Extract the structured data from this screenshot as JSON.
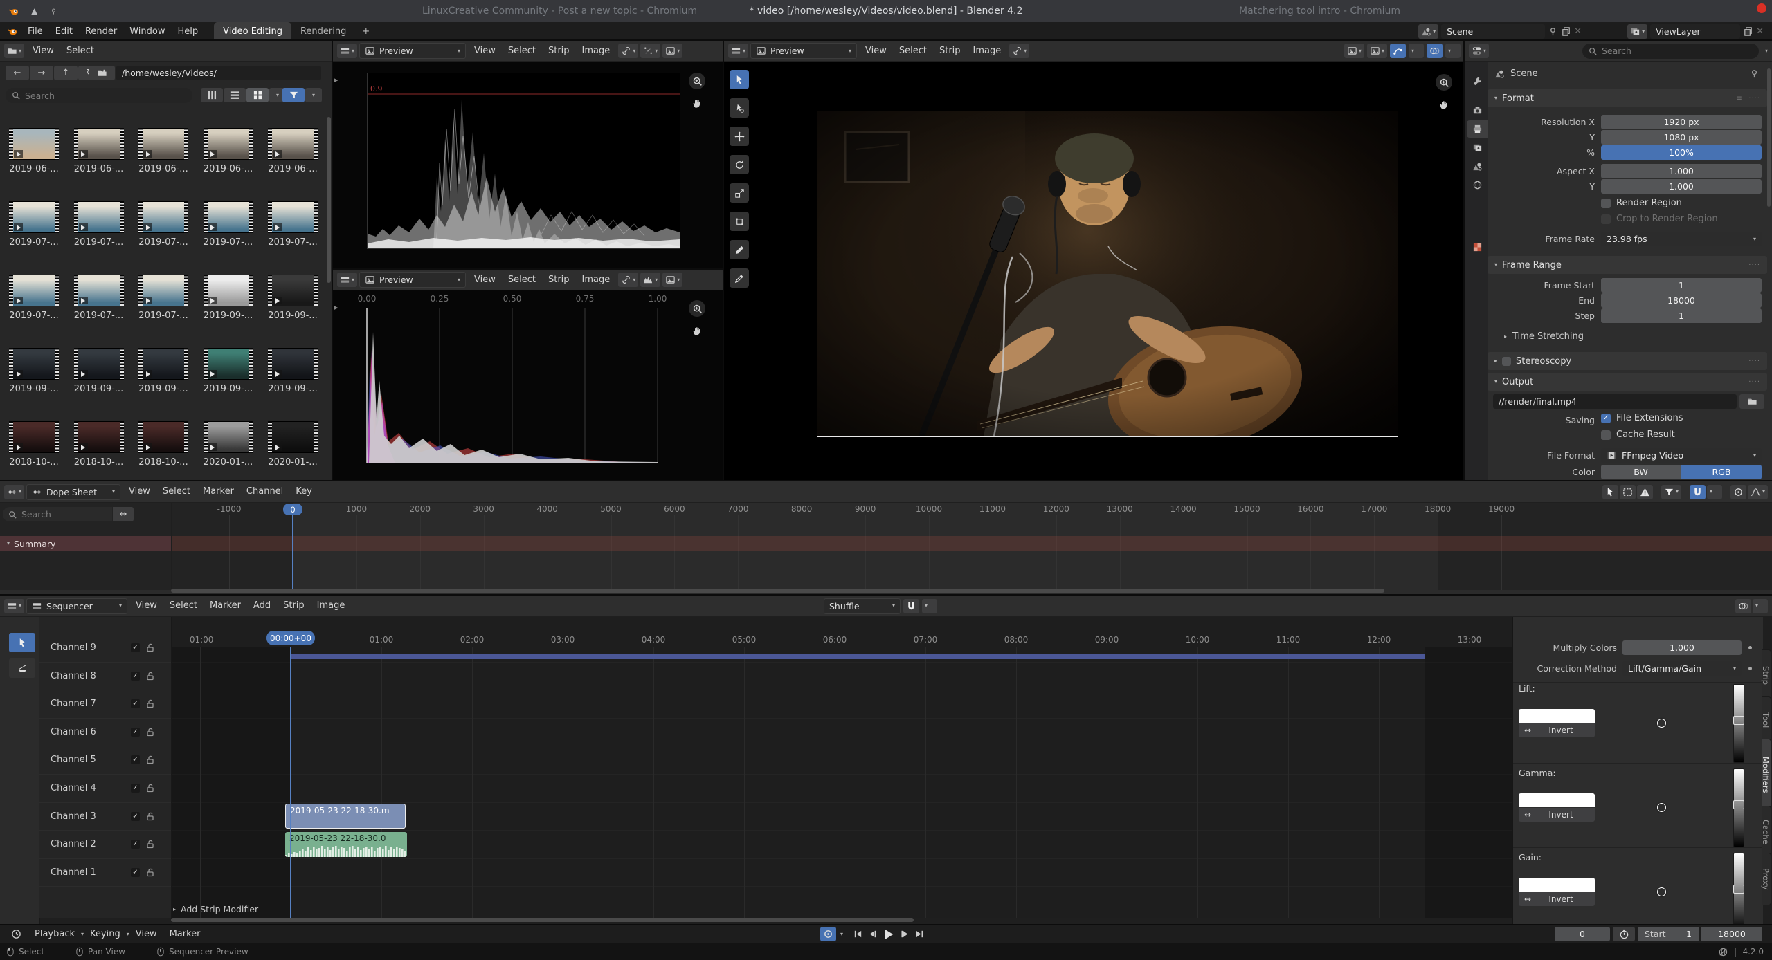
{
  "titlebar": {
    "left_tab": "LinuxCreative Community - Post a new topic - Chromium",
    "title": "* video [/home/wesley/Videos/video.blend] - Blender 4.2",
    "right_tab": "Matchering tool intro - Chromium"
  },
  "topbar": {
    "menus": [
      "File",
      "Edit",
      "Render",
      "Window",
      "Help"
    ],
    "workspaces": [
      {
        "label": "Video Editing",
        "active": true
      },
      {
        "label": "Rendering",
        "active": false
      }
    ],
    "add_tab": "+"
  },
  "scene_selector": {
    "scene": "Scene",
    "view_layer": "ViewLayer"
  },
  "file_browser": {
    "menus": [
      "View",
      "Select"
    ],
    "path": "/home/wesley/Videos/",
    "search_placeholder": "Search",
    "rows": [
      {
        "labels": [
          "2019-06-...",
          "2019-06-...",
          "2019-06-...",
          "2019-06-...",
          "2019-06-..."
        ],
        "colors": [
          [
            "#a8b6bc",
            "#cbb191"
          ],
          [
            "#d6cfbf",
            "#58514a"
          ],
          [
            "#d6cfbf",
            "#58514a"
          ],
          [
            "#d6cfbf",
            "#58514a"
          ],
          [
            "#d6cfbf",
            "#58514a"
          ]
        ]
      },
      {
        "labels": [
          "2019-07-...",
          "2019-07-...",
          "2019-07-...",
          "2019-07-...",
          "2019-07-..."
        ],
        "colors": [
          [
            "#e6e2d6",
            "#47748e"
          ],
          [
            "#e6e2d6",
            "#47748e"
          ],
          [
            "#e6e2d6",
            "#47748e"
          ],
          [
            "#e6e2d6",
            "#47748e"
          ],
          [
            "#e6e2d6",
            "#47748e"
          ]
        ]
      },
      {
        "labels": [
          "2019-07-...",
          "2019-07-...",
          "2019-07-...",
          "2019-09-...",
          "2019-09-..."
        ],
        "colors": [
          [
            "#e6e2d6",
            "#47748e"
          ],
          [
            "#e6e2d6",
            "#47748e"
          ],
          [
            "#e6e2d6",
            "#47748e"
          ],
          [
            "#ededed",
            "#9a9a9a"
          ],
          [
            "#3a3a3a",
            "#181818"
          ]
        ]
      },
      {
        "labels": [
          "2019-09-...",
          "2019-09-...",
          "2019-09-...",
          "2019-09-...",
          "2019-09-..."
        ],
        "colors": [
          [
            "#343a40",
            "#14171c"
          ],
          [
            "#343a40",
            "#14171c"
          ],
          [
            "#343a40",
            "#14171c"
          ],
          [
            "#3f7f74",
            "#1a2e2b"
          ],
          [
            "#30343a",
            "#121418"
          ]
        ]
      },
      {
        "labels": [
          "2018-10-...",
          "2018-10-...",
          "2018-10-...",
          "2020-01-...",
          "2020-01-..."
        ],
        "colors": [
          [
            "#4a2a28",
            "#160e0e"
          ],
          [
            "#4a2a28",
            "#160e0e"
          ],
          [
            "#4a2a28",
            "#160e0e"
          ],
          [
            "#9c9c9c",
            "#383838"
          ],
          [
            "#222222",
            "#0e0e0e"
          ]
        ]
      }
    ]
  },
  "scopes": {
    "mode": "Preview",
    "menus": [
      "View",
      "Select",
      "Strip",
      "Image"
    ],
    "waveform_level_label": "0.9",
    "histogram_ticks": [
      "0.00",
      "0.25",
      "0.50",
      "0.75",
      "1.00"
    ]
  },
  "preview": {
    "mode": "Preview",
    "menus": [
      "View",
      "Select",
      "Strip",
      "Image"
    ]
  },
  "properties": {
    "search_placeholder": "Search",
    "breadcrumb": "Scene",
    "format": {
      "title": "Format",
      "rows": [
        {
          "label": "Resolution X",
          "value": "1920 px"
        },
        {
          "label": "Y",
          "value": "1080 px"
        },
        {
          "label": "%",
          "value": "100%"
        },
        {
          "label": "Aspect X",
          "value": "1.000"
        },
        {
          "label": "Y",
          "value": "1.000"
        }
      ],
      "render_region": "Render Region",
      "crop_to_render_region": "Crop to Render Region",
      "frame_rate_label": "Frame Rate",
      "frame_rate": "23.98 fps"
    },
    "frame_range": {
      "title": "Frame Range",
      "rows": [
        {
          "label": "Frame Start",
          "value": "1"
        },
        {
          "label": "End",
          "value": "18000"
        },
        {
          "label": "Step",
          "value": "1"
        }
      ],
      "time_stretching": "Time Stretching"
    },
    "stereoscopy": "Stereoscopy",
    "output": {
      "title": "Output",
      "path": "//render/final.mp4",
      "saving_label": "Saving",
      "file_extensions": "File Extensions",
      "cache_result": "Cache Result",
      "file_format_label": "File Format",
      "file_format": "FFmpeg Video",
      "color_label": "Color",
      "color_options": [
        "BW",
        "RGB"
      ],
      "color_selected": "RGB"
    }
  },
  "dope_sheet": {
    "mode": "Dope Sheet",
    "menus": [
      "View",
      "Select",
      "Marker",
      "Channel",
      "Key"
    ],
    "search_placeholder": "Search",
    "summary": "Summary",
    "current_frame": "0",
    "ticks": [
      -1000,
      0,
      1000,
      2000,
      3000,
      4000,
      5000,
      6000,
      7000,
      8000,
      9000,
      10000,
      11000,
      12000,
      13000,
      14000,
      15000,
      16000,
      17000,
      18000,
      19000
    ]
  },
  "sequencer": {
    "mode": "Sequencer",
    "menus": [
      "View",
      "Select",
      "Marker",
      "Add",
      "Strip",
      "Image"
    ],
    "blend_mode": "Shuffle",
    "current_time": "00:00+00",
    "channels": [
      "Channel 9",
      "Channel 8",
      "Channel 7",
      "Channel 6",
      "Channel 5",
      "Channel 4",
      "Channel 3",
      "Channel 2",
      "Channel 1"
    ],
    "ruler": [
      {
        "label": "-01:00",
        "minute": -1
      },
      {
        "label": "01:00",
        "minute": 1
      },
      {
        "label": "02:00",
        "minute": 2
      },
      {
        "label": "03:00",
        "minute": 3
      },
      {
        "label": "04:00",
        "minute": 4
      },
      {
        "label": "05:00",
        "minute": 5
      },
      {
        "label": "06:00",
        "minute": 6
      },
      {
        "label": "07:00",
        "minute": 7
      },
      {
        "label": "08:00",
        "minute": 8
      },
      {
        "label": "09:00",
        "minute": 9
      },
      {
        "label": "10:00",
        "minute": 10
      },
      {
        "label": "11:00",
        "minute": 11
      },
      {
        "label": "12:00",
        "minute": 12
      },
      {
        "label": "13:00",
        "minute": 13
      }
    ],
    "video_strip": "2019-05-23 22-18-30.m",
    "audio_strip": "2019-05-23 22-18-30.0",
    "add_strip_modifier": "Add Strip Modifier",
    "sidebar": {
      "multiply_label": "Multiply Colors",
      "multiply_value": "1.000",
      "method_label": "Correction Method",
      "method_value": "Lift/Gamma/Gain",
      "invert_label": "Invert",
      "sections": [
        {
          "label": "Lift:"
        },
        {
          "label": "Gamma:"
        },
        {
          "label": "Gain:"
        }
      ],
      "tabs": [
        {
          "label": "Strip",
          "active": false
        },
        {
          "label": "Tool",
          "active": false
        },
        {
          "label": "Modifiers",
          "active": true
        },
        {
          "label": "Cache",
          "active": false
        },
        {
          "label": "Proxy",
          "active": false
        }
      ]
    }
  },
  "playback_bar": {
    "menus": [
      "Playback",
      "Keying",
      "View",
      "Marker"
    ],
    "frame": "0",
    "start_label": "Start",
    "start_value": "1",
    "end_value": "18000"
  },
  "statusbar": {
    "hints": [
      "Select",
      "Pan View",
      "Sequencer Preview"
    ],
    "version": "4.2.0"
  },
  "colors": {
    "accent": "#4772b3",
    "video_strip": "#7b8eb4",
    "audio_strip": "#79b08f",
    "summary_channel": "#4e3336",
    "playhead": "#5680c2",
    "range_bar": "#4b5796"
  }
}
